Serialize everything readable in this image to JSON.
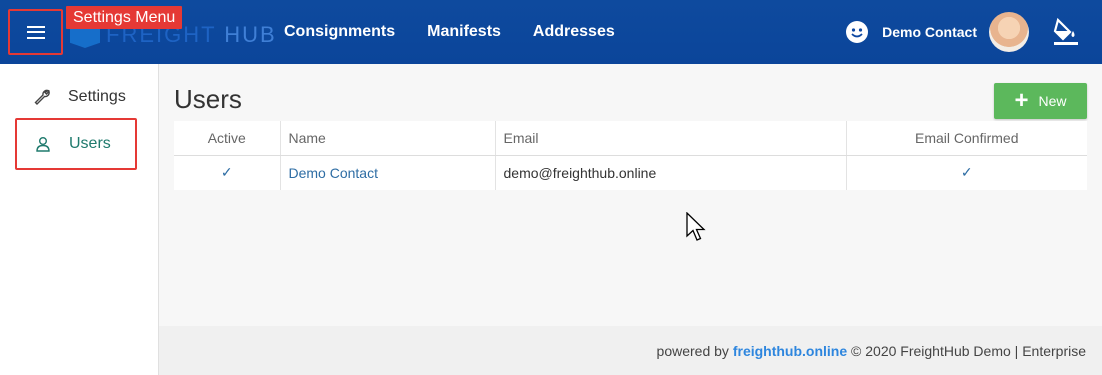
{
  "annotation": {
    "label": "Settings Menu"
  },
  "brand": {
    "name_a": "FREIGHT",
    "name_b": "HUB"
  },
  "nav": {
    "items": [
      "Consignments",
      "Manifests",
      "Addresses"
    ]
  },
  "user": {
    "name": "Demo Contact"
  },
  "sidebar": {
    "items": [
      {
        "label": "Settings",
        "icon": "wrench-icon"
      },
      {
        "label": "Users",
        "icon": "user-icon"
      }
    ]
  },
  "main": {
    "title": "Users",
    "new_label": "New"
  },
  "table": {
    "columns": [
      "Active",
      "Name",
      "Email",
      "Email Confirmed"
    ],
    "rows": [
      {
        "active": true,
        "name": "Demo Contact",
        "email": "demo@freighthub.online",
        "email_confirmed": true
      }
    ]
  },
  "footer": {
    "prefix": "powered by ",
    "link": "freighthub.online",
    "suffix": " © 2020 FreightHub Demo | Enterprise"
  },
  "colors": {
    "navbar": "#0d47a1",
    "accent_green": "#5cb85c",
    "highlight_red": "#e53935",
    "active_teal": "#1f7a6d"
  }
}
